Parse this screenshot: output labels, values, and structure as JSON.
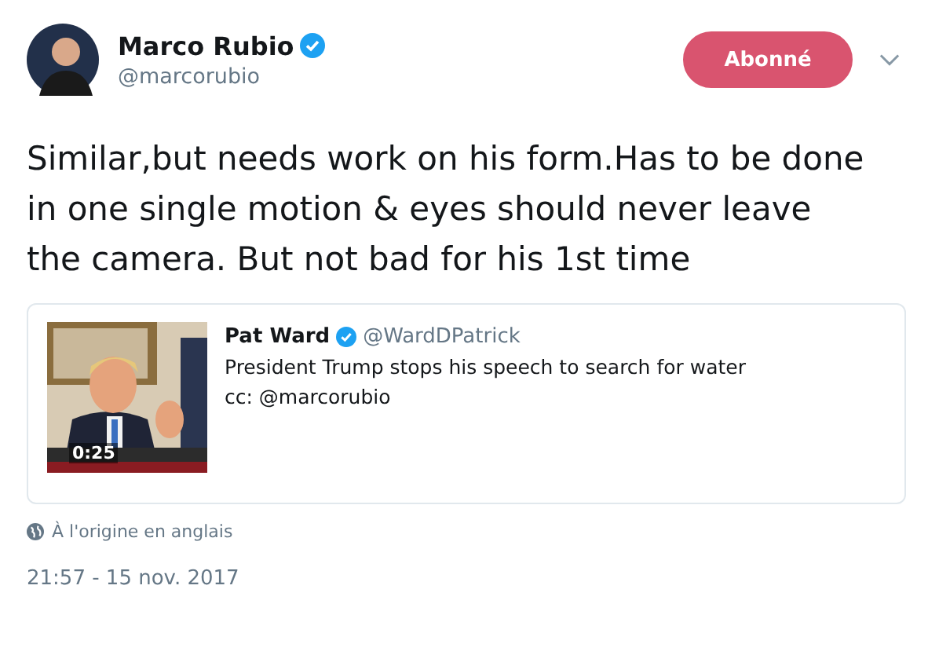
{
  "author": {
    "name": "Marco Rubio",
    "verified": true,
    "handle": "@marcorubio"
  },
  "follow_button": {
    "label": "Abonné",
    "following": true
  },
  "tweet_text": "Similar,but needs work on his form.Has to be done in one single motion & eyes should never leave the camera. But not bad for his 1st time",
  "quoted_tweet": {
    "media": {
      "kind": "picture",
      "duration": "0:25"
    },
    "author_name": "Pat Ward",
    "verified": true,
    "handle": "@WardDPatrick",
    "lines": [
      "President Trump stops his speech to search for water",
      "cc: @marcorubio"
    ]
  },
  "translation_note": "À l'origine en anglais",
  "timestamp": "21:57 - 15 nov. 2017"
}
